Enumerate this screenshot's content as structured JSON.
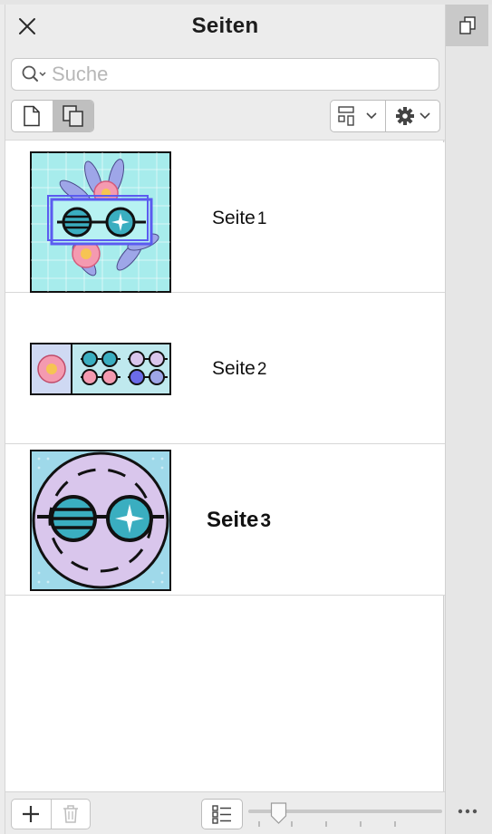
{
  "panel": {
    "title": "Seiten",
    "close_icon": "close-icon"
  },
  "search": {
    "placeholder": "Suche",
    "value": "",
    "icon": "search-icon"
  },
  "toolbar": {
    "view_single_icon": "single-page-icon",
    "view_multi_icon": "multi-page-icon",
    "layout_icon": "layout-options-icon",
    "settings_icon": "gear-icon"
  },
  "pages": [
    {
      "word": "Seite",
      "number": "1",
      "bold": false,
      "thumb_bg": "#a7ecec"
    },
    {
      "word": "Seite",
      "number": "2",
      "bold": false,
      "thumb_bg": "#bfe9ee"
    },
    {
      "word": "Seite",
      "number": "3",
      "bold": true,
      "thumb_bg": "#9fd9ea"
    }
  ],
  "footer": {
    "add_icon": "plus-icon",
    "delete_icon": "trash-icon",
    "details_icon": "list-view-icon",
    "zoom_level": 0.15
  },
  "docker": {
    "tab_icon": "pages-docker-icon",
    "more_icon": "more-icon"
  },
  "colors": {
    "accent_teal": "#3aaec0",
    "flower_pink": "#f49ab0",
    "frame_blue": "#5b5bf0",
    "leaf_purple": "#9ea6e8",
    "lavender": "#d9c6ec"
  }
}
